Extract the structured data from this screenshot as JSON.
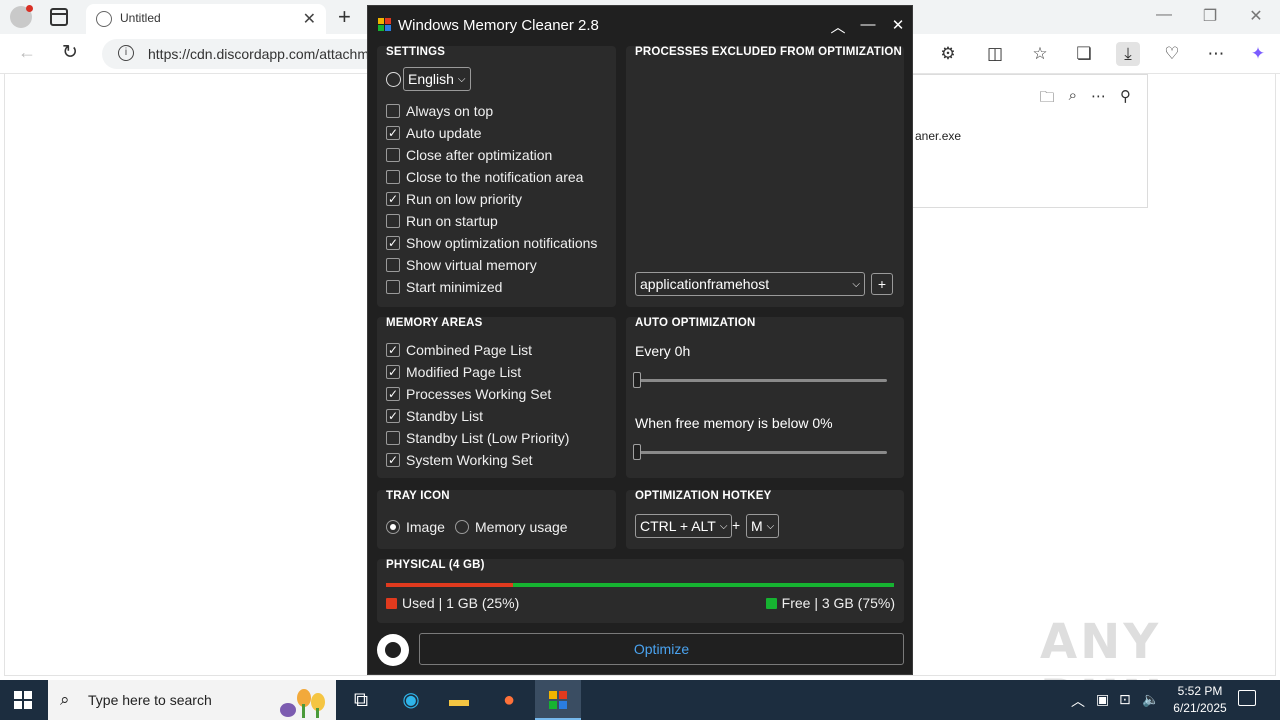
{
  "browser": {
    "tab_title": "Untitled",
    "url": "https://cdn.discordapp.com/attachm",
    "download_file": "aner.exe"
  },
  "watermark": "ANY RUN",
  "app": {
    "title": "Windows Memory Cleaner 2.8",
    "settings": {
      "title": "SETTINGS",
      "language": "English",
      "options": [
        {
          "label": "Always on top",
          "checked": false
        },
        {
          "label": "Auto update",
          "checked": true
        },
        {
          "label": "Close after optimization",
          "checked": false
        },
        {
          "label": "Close to the notification area",
          "checked": false
        },
        {
          "label": "Run on low priority",
          "checked": true
        },
        {
          "label": "Run on startup",
          "checked": false
        },
        {
          "label": "Show optimization notifications",
          "checked": true
        },
        {
          "label": "Show virtual memory",
          "checked": false
        },
        {
          "label": "Start minimized",
          "checked": false
        }
      ]
    },
    "excluded": {
      "title": "PROCESSES EXCLUDED FROM OPTIMIZATION",
      "process_select": "applicationframehost",
      "add_label": "+"
    },
    "memory_areas": {
      "title": "MEMORY AREAS",
      "options": [
        {
          "label": "Combined Page List",
          "checked": true
        },
        {
          "label": "Modified Page List",
          "checked": true
        },
        {
          "label": "Processes Working Set",
          "checked": true
        },
        {
          "label": "Standby List",
          "checked": true
        },
        {
          "label": "Standby List (Low Priority)",
          "checked": false
        },
        {
          "label": "System Working Set",
          "checked": true
        }
      ]
    },
    "auto_optimization": {
      "title": "AUTO OPTIMIZATION",
      "every_label": "Every 0h",
      "every_value": 0,
      "free_label": "When free memory is below 0%",
      "free_value": 0
    },
    "tray_icon": {
      "title": "TRAY ICON",
      "options": [
        {
          "label": "Image",
          "selected": true
        },
        {
          "label": "Memory usage",
          "selected": false
        }
      ]
    },
    "hotkey": {
      "title": "OPTIMIZATION HOTKEY",
      "modifier": "CTRL + ALT",
      "plus": "+",
      "key": "M"
    },
    "physical": {
      "title": "PHYSICAL (4 GB)",
      "used_label": "Used | 1 GB (25%)",
      "free_label": "Free | 3 GB (75%)",
      "used_percent": 25,
      "used_color": "#e03a1e",
      "free_color": "#16b331"
    },
    "optimize_label": "Optimize"
  },
  "taskbar": {
    "search_placeholder": "Type here to search",
    "time": "5:52 PM",
    "date": "6/21/2025"
  }
}
